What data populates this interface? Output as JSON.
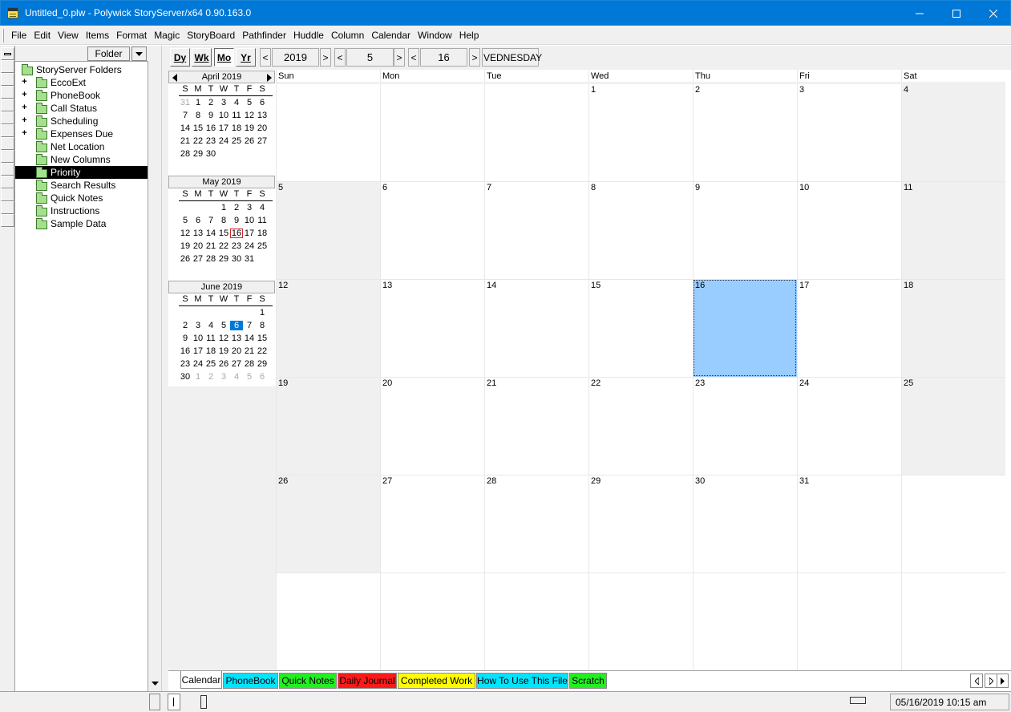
{
  "window": {
    "title": "Untitled_0.plw - Polywick StoryServer/x64 0.90.163.0",
    "minimize_icon": "minimize-icon",
    "maximize_icon": "maximize-icon",
    "close_icon": "close-icon"
  },
  "menu": [
    "File",
    "Edit",
    "View",
    "Items",
    "Format",
    "Magic",
    "StoryBoard",
    "Pathfinder",
    "Huddle",
    "Column",
    "Calendar",
    "Window",
    "Help"
  ],
  "folder_pane": {
    "header_button": "Folder",
    "items": [
      {
        "label": "StoryServer Folders",
        "level": 0,
        "expandable": false
      },
      {
        "label": "EccoExt",
        "level": 1,
        "expandable": true
      },
      {
        "label": "PhoneBook",
        "level": 1,
        "expandable": true
      },
      {
        "label": "Call Status",
        "level": 1,
        "expandable": true
      },
      {
        "label": "Scheduling",
        "level": 1,
        "expandable": true
      },
      {
        "label": "Expenses Due",
        "level": 1,
        "expandable": true
      },
      {
        "label": "Net Location",
        "level": 1,
        "expandable": false
      },
      {
        "label": "New Columns",
        "level": 1,
        "expandable": false
      },
      {
        "label": "Priority",
        "level": 1,
        "expandable": false,
        "selected": true
      },
      {
        "label": "Search Results",
        "level": 1,
        "expandable": false
      },
      {
        "label": "Quick Notes",
        "level": 1,
        "expandable": false
      },
      {
        "label": "Instructions",
        "level": 1,
        "expandable": false
      },
      {
        "label": "Sample Data",
        "level": 1,
        "expandable": false
      }
    ]
  },
  "toolbar": {
    "view_buttons": [
      "Dy",
      "Wk",
      "Mo",
      "Yr"
    ],
    "active_view": "Mo",
    "year": "2019",
    "month": "5",
    "day": "16",
    "weekday": "VEDNESDAY",
    "prev": "<",
    "next": ">"
  },
  "mini_calendars": [
    {
      "title": "April 2019",
      "dow": [
        "S",
        "M",
        "T",
        "W",
        "T",
        "F",
        "S"
      ],
      "weeks": [
        [
          "31",
          "1",
          "2",
          "3",
          "4",
          "5",
          "6"
        ],
        [
          "7",
          "8",
          "9",
          "10",
          "11",
          "12",
          "13"
        ],
        [
          "14",
          "15",
          "16",
          "17",
          "18",
          "19",
          "20"
        ],
        [
          "21",
          "22",
          "23",
          "24",
          "25",
          "26",
          "27"
        ],
        [
          "28",
          "29",
          "30",
          "",
          "",
          "",
          ""
        ]
      ],
      "faded_first_row_prefix": 1
    },
    {
      "title": "May 2019",
      "dow": [
        "S",
        "M",
        "T",
        "W",
        "T",
        "F",
        "S"
      ],
      "weeks": [
        [
          "",
          "",
          "",
          "1",
          "2",
          "3",
          "4"
        ],
        [
          "5",
          "6",
          "7",
          "8",
          "9",
          "10",
          "11"
        ],
        [
          "12",
          "13",
          "14",
          "15",
          "16",
          "17",
          "18"
        ],
        [
          "19",
          "20",
          "21",
          "22",
          "23",
          "24",
          "25"
        ],
        [
          "26",
          "27",
          "28",
          "29",
          "30",
          "31",
          ""
        ]
      ],
      "today": "16"
    },
    {
      "title": "June 2019",
      "dow": [
        "S",
        "M",
        "T",
        "W",
        "T",
        "F",
        "S"
      ],
      "weeks": [
        [
          "",
          "",
          "",
          "",
          "",
          "",
          "1"
        ],
        [
          "2",
          "3",
          "4",
          "5",
          "6",
          "7",
          "8"
        ],
        [
          "9",
          "10",
          "11",
          "12",
          "13",
          "14",
          "15"
        ],
        [
          "16",
          "17",
          "18",
          "19",
          "20",
          "21",
          "22"
        ],
        [
          "23",
          "24",
          "25",
          "26",
          "27",
          "28",
          "29"
        ],
        [
          "30",
          "1",
          "2",
          "3",
          "4",
          "5",
          "6"
        ]
      ],
      "selected": "6"
    }
  ],
  "month_view": {
    "days_of_week": [
      "Sun",
      "Mon",
      "Tue",
      "Wed",
      "Thu",
      "Fri",
      "Sat"
    ],
    "weeks": [
      [
        "",
        "",
        "",
        "1",
        "2",
        "3",
        "4"
      ],
      [
        "5",
        "6",
        "7",
        "8",
        "9",
        "10",
        "11"
      ],
      [
        "12",
        "13",
        "14",
        "15",
        "16",
        "17",
        "18"
      ],
      [
        "19",
        "20",
        "21",
        "22",
        "23",
        "24",
        "25"
      ],
      [
        "26",
        "27",
        "28",
        "29",
        "30",
        "31",
        ""
      ],
      [
        "",
        "",
        "",
        "",
        "",
        "",
        ""
      ]
    ],
    "highlighted_day": "16"
  },
  "tabs": [
    {
      "label": "Calendar",
      "color": "#ffffff"
    },
    {
      "label": "PhoneBook",
      "color": "#00e5ff"
    },
    {
      "label": "Quick Notes",
      "color": "#22ee22"
    },
    {
      "label": "Daily Journal",
      "color": "#ff1a1a"
    },
    {
      "label": "Completed Work",
      "color": "#ffff00"
    },
    {
      "label": "How To Use This File",
      "color": "#00e5ff"
    },
    {
      "label": "Scratch",
      "color": "#22ee22"
    }
  ],
  "status": {
    "datetime": "05/16/2019 10:15 am"
  }
}
